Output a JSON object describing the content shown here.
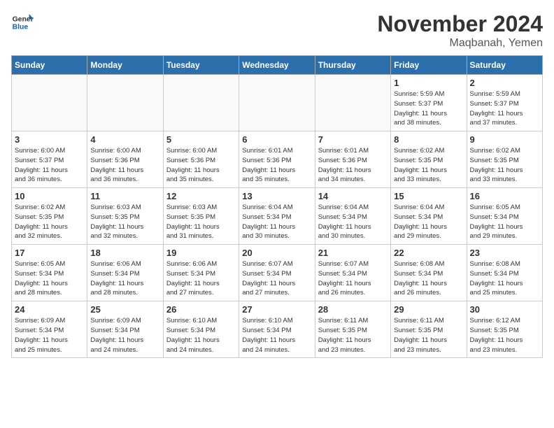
{
  "header": {
    "logo_line1": "General",
    "logo_line2": "Blue",
    "month": "November 2024",
    "location": "Maqbanah, Yemen"
  },
  "days_of_week": [
    "Sunday",
    "Monday",
    "Tuesday",
    "Wednesday",
    "Thursday",
    "Friday",
    "Saturday"
  ],
  "weeks": [
    [
      {
        "day": "",
        "info": ""
      },
      {
        "day": "",
        "info": ""
      },
      {
        "day": "",
        "info": ""
      },
      {
        "day": "",
        "info": ""
      },
      {
        "day": "",
        "info": ""
      },
      {
        "day": "1",
        "info": "Sunrise: 5:59 AM\nSunset: 5:37 PM\nDaylight: 11 hours\nand 38 minutes."
      },
      {
        "day": "2",
        "info": "Sunrise: 5:59 AM\nSunset: 5:37 PM\nDaylight: 11 hours\nand 37 minutes."
      }
    ],
    [
      {
        "day": "3",
        "info": "Sunrise: 6:00 AM\nSunset: 5:37 PM\nDaylight: 11 hours\nand 36 minutes."
      },
      {
        "day": "4",
        "info": "Sunrise: 6:00 AM\nSunset: 5:36 PM\nDaylight: 11 hours\nand 36 minutes."
      },
      {
        "day": "5",
        "info": "Sunrise: 6:00 AM\nSunset: 5:36 PM\nDaylight: 11 hours\nand 35 minutes."
      },
      {
        "day": "6",
        "info": "Sunrise: 6:01 AM\nSunset: 5:36 PM\nDaylight: 11 hours\nand 35 minutes."
      },
      {
        "day": "7",
        "info": "Sunrise: 6:01 AM\nSunset: 5:36 PM\nDaylight: 11 hours\nand 34 minutes."
      },
      {
        "day": "8",
        "info": "Sunrise: 6:02 AM\nSunset: 5:35 PM\nDaylight: 11 hours\nand 33 minutes."
      },
      {
        "day": "9",
        "info": "Sunrise: 6:02 AM\nSunset: 5:35 PM\nDaylight: 11 hours\nand 33 minutes."
      }
    ],
    [
      {
        "day": "10",
        "info": "Sunrise: 6:02 AM\nSunset: 5:35 PM\nDaylight: 11 hours\nand 32 minutes."
      },
      {
        "day": "11",
        "info": "Sunrise: 6:03 AM\nSunset: 5:35 PM\nDaylight: 11 hours\nand 32 minutes."
      },
      {
        "day": "12",
        "info": "Sunrise: 6:03 AM\nSunset: 5:35 PM\nDaylight: 11 hours\nand 31 minutes."
      },
      {
        "day": "13",
        "info": "Sunrise: 6:04 AM\nSunset: 5:34 PM\nDaylight: 11 hours\nand 30 minutes."
      },
      {
        "day": "14",
        "info": "Sunrise: 6:04 AM\nSunset: 5:34 PM\nDaylight: 11 hours\nand 30 minutes."
      },
      {
        "day": "15",
        "info": "Sunrise: 6:04 AM\nSunset: 5:34 PM\nDaylight: 11 hours\nand 29 minutes."
      },
      {
        "day": "16",
        "info": "Sunrise: 6:05 AM\nSunset: 5:34 PM\nDaylight: 11 hours\nand 29 minutes."
      }
    ],
    [
      {
        "day": "17",
        "info": "Sunrise: 6:05 AM\nSunset: 5:34 PM\nDaylight: 11 hours\nand 28 minutes."
      },
      {
        "day": "18",
        "info": "Sunrise: 6:06 AM\nSunset: 5:34 PM\nDaylight: 11 hours\nand 28 minutes."
      },
      {
        "day": "19",
        "info": "Sunrise: 6:06 AM\nSunset: 5:34 PM\nDaylight: 11 hours\nand 27 minutes."
      },
      {
        "day": "20",
        "info": "Sunrise: 6:07 AM\nSunset: 5:34 PM\nDaylight: 11 hours\nand 27 minutes."
      },
      {
        "day": "21",
        "info": "Sunrise: 6:07 AM\nSunset: 5:34 PM\nDaylight: 11 hours\nand 26 minutes."
      },
      {
        "day": "22",
        "info": "Sunrise: 6:08 AM\nSunset: 5:34 PM\nDaylight: 11 hours\nand 26 minutes."
      },
      {
        "day": "23",
        "info": "Sunrise: 6:08 AM\nSunset: 5:34 PM\nDaylight: 11 hours\nand 25 minutes."
      }
    ],
    [
      {
        "day": "24",
        "info": "Sunrise: 6:09 AM\nSunset: 5:34 PM\nDaylight: 11 hours\nand 25 minutes."
      },
      {
        "day": "25",
        "info": "Sunrise: 6:09 AM\nSunset: 5:34 PM\nDaylight: 11 hours\nand 24 minutes."
      },
      {
        "day": "26",
        "info": "Sunrise: 6:10 AM\nSunset: 5:34 PM\nDaylight: 11 hours\nand 24 minutes."
      },
      {
        "day": "27",
        "info": "Sunrise: 6:10 AM\nSunset: 5:34 PM\nDaylight: 11 hours\nand 24 minutes."
      },
      {
        "day": "28",
        "info": "Sunrise: 6:11 AM\nSunset: 5:35 PM\nDaylight: 11 hours\nand 23 minutes."
      },
      {
        "day": "29",
        "info": "Sunrise: 6:11 AM\nSunset: 5:35 PM\nDaylight: 11 hours\nand 23 minutes."
      },
      {
        "day": "30",
        "info": "Sunrise: 6:12 AM\nSunset: 5:35 PM\nDaylight: 11 hours\nand 23 minutes."
      }
    ]
  ]
}
